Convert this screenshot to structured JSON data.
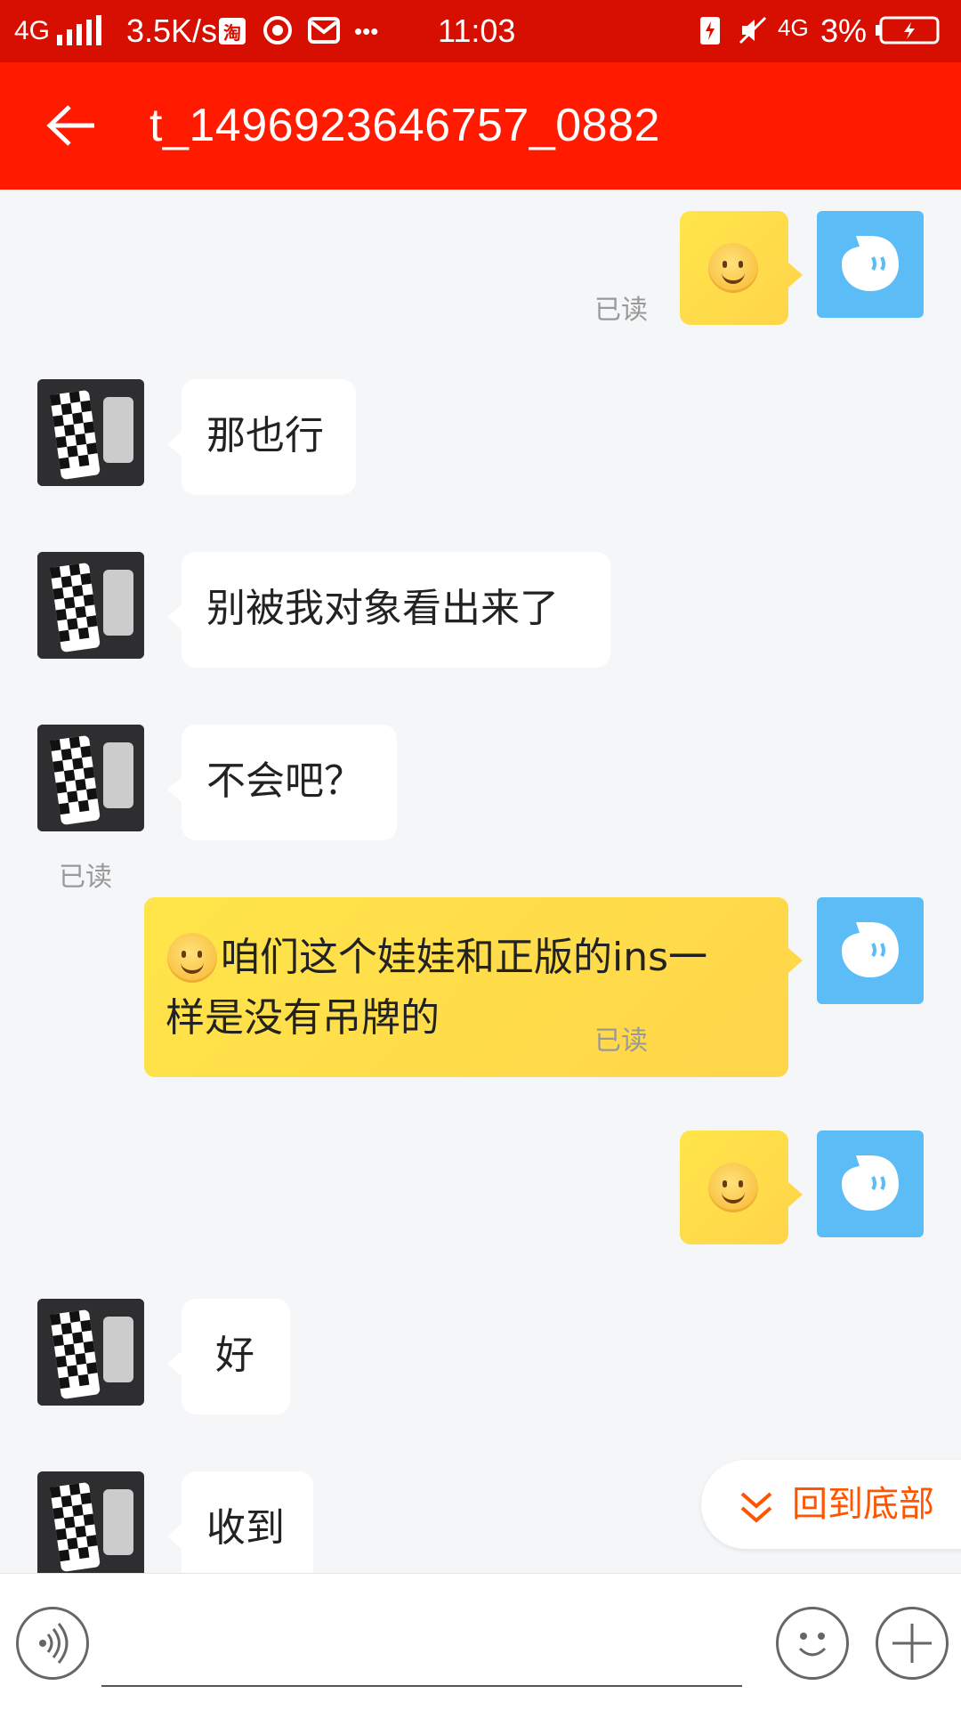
{
  "status_bar": {
    "network": "4G",
    "speed": "3.5K/s",
    "taobao_badge": "淘",
    "dots": "•••",
    "time": "11:03",
    "network2": "4G",
    "battery": "3%"
  },
  "header": {
    "title": "t_1496923646757_0882"
  },
  "messages": [
    {
      "sender": "me",
      "type": "emoji",
      "read": "已读"
    },
    {
      "sender": "other",
      "text": "那也行"
    },
    {
      "sender": "other",
      "text": "别被我对象看出来了"
    },
    {
      "sender": "other",
      "text": "不会吧？"
    },
    {
      "sender": "me",
      "line1": "咱们这个娃娃和正版的ins一",
      "line2": "样是没有吊牌的",
      "read": "已读"
    },
    {
      "sender": "me",
      "type": "emoji",
      "read": "已读"
    },
    {
      "sender": "other",
      "text": "好"
    },
    {
      "sender": "other",
      "text": "收到"
    }
  ],
  "return_bottom": "回到底部",
  "colors": {
    "status_bar": "#d70f00",
    "title_bar": "#ff1a00",
    "my_bubble": "#ffd84a",
    "my_avatar": "#5cbcf6",
    "accent": "#ff5500"
  },
  "icons": [
    "back-arrow-icon",
    "voice-icon",
    "emoji-icon",
    "plus-icon",
    "chevron-down-double-icon"
  ]
}
